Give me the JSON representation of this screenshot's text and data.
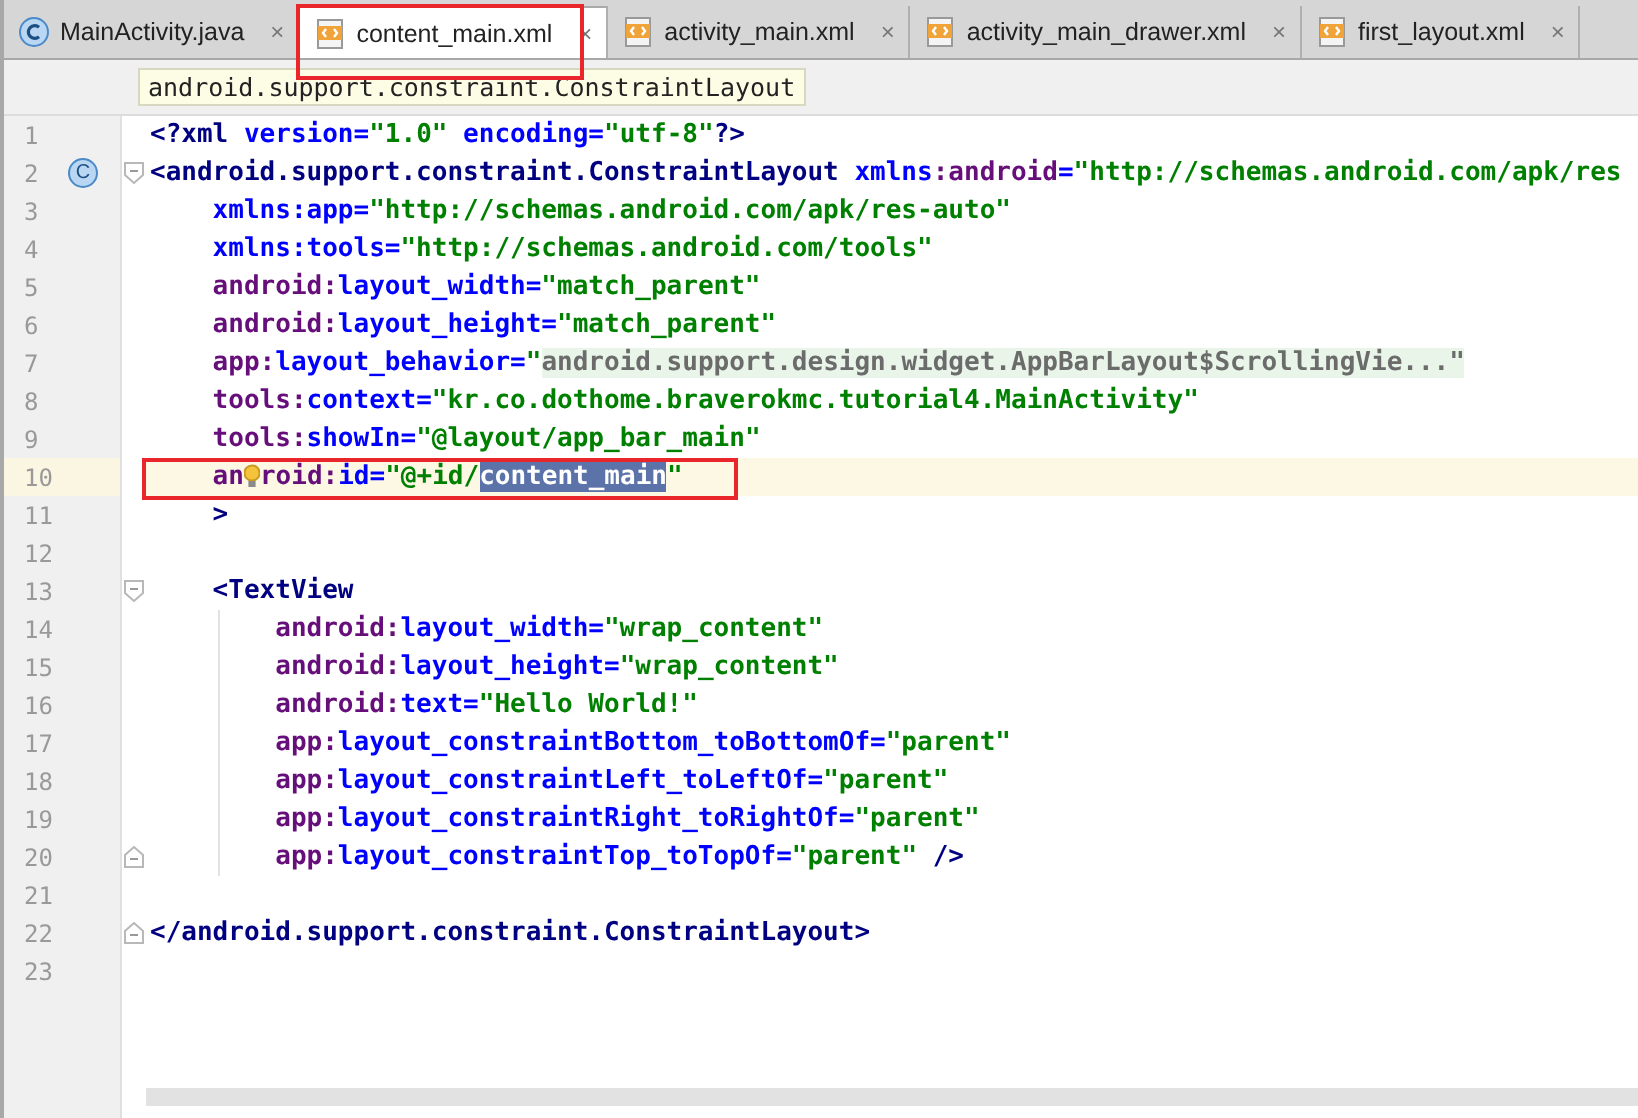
{
  "tabs": [
    {
      "label": "MainActivity.java",
      "kind": "java",
      "selected": false,
      "framed": false
    },
    {
      "label": "content_main.xml",
      "kind": "xml",
      "selected": true,
      "framed": true
    },
    {
      "label": "activity_main.xml",
      "kind": "xml",
      "selected": false,
      "framed": false
    },
    {
      "label": "activity_main_drawer.xml",
      "kind": "xml",
      "selected": false,
      "framed": false
    },
    {
      "label": "first_layout.xml",
      "kind": "xml",
      "selected": false,
      "framed": false
    }
  ],
  "close_glyph": "×",
  "class_marker_glyph": "C",
  "breadcrumb": "android.support.constraint.ConstraintLayout",
  "lines": [
    {
      "number": "1",
      "current": false,
      "framed": false,
      "tokens": [
        {
          "kind": "tag",
          "t": "<?xml"
        },
        {
          "kind": "attr",
          "t": " version="
        },
        {
          "kind": "value",
          "t": "\"1.0\""
        },
        {
          "kind": "attr",
          "t": " encoding="
        },
        {
          "kind": "value",
          "t": "\"utf-8\""
        },
        {
          "kind": "tag",
          "t": "?>"
        }
      ]
    },
    {
      "number": "2",
      "current": false,
      "framed": false,
      "markers": [
        {
          "kind": "class"
        },
        {
          "kind": "fold-start"
        }
      ],
      "tokens": [
        {
          "kind": "tag",
          "t": "<android.support.constraint.ConstraintLayout"
        },
        {
          "kind": "attr",
          "t": " xmlns"
        },
        {
          "kind": "ns",
          "t": ":android"
        },
        {
          "kind": "attr",
          "t": "="
        },
        {
          "kind": "value",
          "t": "\"http://schemas.android.com/apk/res"
        }
      ]
    },
    {
      "number": "3",
      "current": false,
      "framed": false,
      "tokens": [
        {
          "kind": "attr",
          "t": "    xmlns:app="
        },
        {
          "kind": "value",
          "t": "\"http://schemas.android.com/apk/res-auto\""
        }
      ]
    },
    {
      "number": "4",
      "current": false,
      "framed": false,
      "tokens": [
        {
          "kind": "attr",
          "t": "    xmlns:tools="
        },
        {
          "kind": "value",
          "t": "\"http://schemas.android.com/tools\""
        }
      ]
    },
    {
      "number": "5",
      "current": false,
      "framed": false,
      "tokens": [
        {
          "kind": "ns",
          "t": "    android:"
        },
        {
          "kind": "attr",
          "t": "layout_width="
        },
        {
          "kind": "value",
          "t": "\"match_parent\""
        }
      ]
    },
    {
      "number": "6",
      "current": false,
      "framed": false,
      "tokens": [
        {
          "kind": "ns",
          "t": "    android:"
        },
        {
          "kind": "attr",
          "t": "layout_height="
        },
        {
          "kind": "value",
          "t": "\"match_parent\""
        }
      ]
    },
    {
      "number": "7",
      "current": false,
      "framed": false,
      "tokens": [
        {
          "kind": "ns",
          "t": "    app:"
        },
        {
          "kind": "attr",
          "t": "layout_behavior="
        },
        {
          "kind": "value",
          "t": "\""
        },
        {
          "kind": "folded",
          "t": "android.support.design.widget.AppBarLayout$ScrollingVie...\""
        }
      ]
    },
    {
      "number": "8",
      "current": false,
      "framed": false,
      "tokens": [
        {
          "kind": "ns",
          "t": "    tools:"
        },
        {
          "kind": "attr",
          "t": "context="
        },
        {
          "kind": "value",
          "t": "\"kr.co.dothome.braverokmc.tutorial4.MainActivity\""
        }
      ]
    },
    {
      "number": "9",
      "current": false,
      "framed": false,
      "tokens": [
        {
          "kind": "ns",
          "t": "    tools:"
        },
        {
          "kind": "attr",
          "t": "showIn="
        },
        {
          "kind": "value",
          "t": "\"@layout/app_bar_main\""
        }
      ]
    },
    {
      "number": "10",
      "current": true,
      "framed": true,
      "tokens": [
        {
          "kind": "ns",
          "t": "    an"
        },
        {
          "kind": "bulb"
        },
        {
          "kind": "ns",
          "t": "roid:"
        },
        {
          "kind": "attr",
          "t": "id="
        },
        {
          "kind": "value",
          "t": "\"@+id/"
        },
        {
          "kind": "selected",
          "t": "content_main"
        },
        {
          "kind": "value",
          "t": "\""
        }
      ]
    },
    {
      "number": "11",
      "current": false,
      "framed": false,
      "tokens": [
        {
          "kind": "tag",
          "t": "    >"
        }
      ]
    },
    {
      "number": "12",
      "current": false,
      "framed": false
    },
    {
      "number": "13",
      "current": false,
      "framed": false,
      "markers": [
        {
          "kind": "fold-start"
        }
      ],
      "tokens": [
        {
          "kind": "tag",
          "t": "    <TextView"
        }
      ]
    },
    {
      "number": "14",
      "current": false,
      "framed": false,
      "markers": [
        {
          "kind": "indent-guide"
        }
      ],
      "tokens": [
        {
          "kind": "ns",
          "t": "        android:"
        },
        {
          "kind": "attr",
          "t": "layout_width="
        },
        {
          "kind": "value",
          "t": "\"wrap_content\""
        }
      ]
    },
    {
      "number": "15",
      "current": false,
      "framed": false,
      "markers": [
        {
          "kind": "indent-guide"
        }
      ],
      "tokens": [
        {
          "kind": "ns",
          "t": "        android:"
        },
        {
          "kind": "attr",
          "t": "layout_height="
        },
        {
          "kind": "value",
          "t": "\"wrap_content\""
        }
      ]
    },
    {
      "number": "16",
      "current": false,
      "framed": false,
      "markers": [
        {
          "kind": "indent-guide"
        }
      ],
      "tokens": [
        {
          "kind": "ns",
          "t": "        android:"
        },
        {
          "kind": "attr",
          "t": "text="
        },
        {
          "kind": "value",
          "t": "\"Hello World!\""
        }
      ]
    },
    {
      "number": "17",
      "current": false,
      "framed": false,
      "markers": [
        {
          "kind": "indent-guide"
        }
      ],
      "tokens": [
        {
          "kind": "ns",
          "t": "        app:"
        },
        {
          "kind": "attr",
          "t": "layout_constraintBottom_toBottomOf="
        },
        {
          "kind": "value",
          "t": "\"parent\""
        }
      ]
    },
    {
      "number": "18",
      "current": false,
      "framed": false,
      "markers": [
        {
          "kind": "indent-guide"
        }
      ],
      "tokens": [
        {
          "kind": "ns",
          "t": "        app:"
        },
        {
          "kind": "attr",
          "t": "layout_constraintLeft_toLeftOf="
        },
        {
          "kind": "value",
          "t": "\"parent\""
        }
      ]
    },
    {
      "number": "19",
      "current": false,
      "framed": false,
      "markers": [
        {
          "kind": "indent-guide"
        }
      ],
      "tokens": [
        {
          "kind": "ns",
          "t": "        app:"
        },
        {
          "kind": "attr",
          "t": "layout_constraintRight_toRightOf="
        },
        {
          "kind": "value",
          "t": "\"parent\""
        }
      ]
    },
    {
      "number": "20",
      "current": false,
      "framed": false,
      "markers": [
        {
          "kind": "fold-end"
        },
        {
          "kind": "indent-guide"
        }
      ],
      "tokens": [
        {
          "kind": "ns",
          "t": "        app:"
        },
        {
          "kind": "attr",
          "t": "layout_constraintTop_toTopOf="
        },
        {
          "kind": "value",
          "t": "\"parent\""
        },
        {
          "kind": "tag",
          "t": " />"
        }
      ]
    },
    {
      "number": "21",
      "current": false,
      "framed": false
    },
    {
      "number": "22",
      "current": false,
      "framed": false,
      "markers": [
        {
          "kind": "fold-end"
        }
      ],
      "tokens": [
        {
          "kind": "tag",
          "t": "</android.support.constraint.ConstraintLayout>"
        }
      ]
    },
    {
      "number": "23",
      "current": false,
      "framed": false
    }
  ]
}
